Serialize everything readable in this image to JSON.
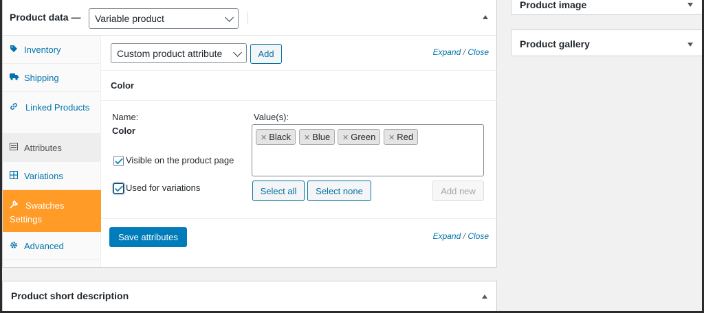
{
  "product_data": {
    "title": "Product data —",
    "type_select": "Variable product"
  },
  "tabs": [
    {
      "label": "Inventory",
      "icon": "tag-icon"
    },
    {
      "label": "Shipping",
      "icon": "truck-icon"
    },
    {
      "label": "Linked Products",
      "icon": "link-icon"
    },
    {
      "label": "Attributes",
      "icon": "list-icon"
    },
    {
      "label": "Variations",
      "icon": "grid-icon"
    },
    {
      "label": "Swatches Settings",
      "icon": "wrench-icon"
    },
    {
      "label": "Advanced",
      "icon": "gear-icon"
    }
  ],
  "attributes": {
    "select_value": "Custom product attribute",
    "add_label": "Add",
    "expand_label": "Expand",
    "separator": "/",
    "close_label": "Close",
    "attribute_heading": "Color",
    "name_label": "Name:",
    "name_value": "Color",
    "values_label": "Value(s):",
    "values": [
      "Black",
      "Blue",
      "Green",
      "Red"
    ],
    "visible_label": "Visible on the product page",
    "variations_label": "Used for variations",
    "select_all_label": "Select all",
    "select_none_label": "Select none",
    "add_new_label": "Add new",
    "save_label": "Save attributes"
  },
  "short_description": {
    "title": "Product short description"
  },
  "sidebar": {
    "product_image_title": "Product image",
    "product_gallery_title": "Product gallery"
  },
  "colors": {
    "accent": "#0073aa",
    "active_tab": "#ff9b26",
    "primary_button": "#007cba"
  }
}
